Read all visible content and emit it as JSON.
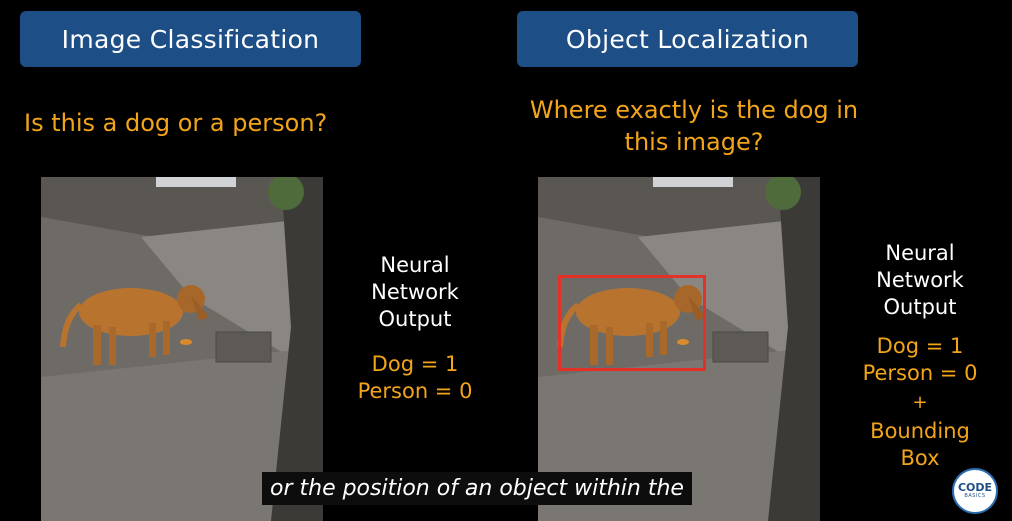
{
  "left_panel": {
    "title": "Image Classification",
    "question": "Is this a dog or a person?",
    "nn_output_label": [
      "Neural",
      "Network",
      "Output"
    ],
    "outputs": [
      "Dog = 1",
      "Person = 0"
    ]
  },
  "right_panel": {
    "title": "Object Localization",
    "question_lines": [
      "Where exactly is the dog in",
      "this image?"
    ],
    "nn_output_label": [
      "Neural",
      "Network",
      "Output"
    ],
    "outputs": [
      "Dog = 1",
      "Person = 0"
    ],
    "plus": "+",
    "extra_output": [
      "Bounding",
      "Box"
    ]
  },
  "caption": "or the position of an object within the",
  "logo": {
    "line1": "CODE",
    "line2": "BASICS"
  },
  "colors": {
    "title_bg": "#1d4e86",
    "question": "#f3a51a",
    "bounding_box": "#e53025"
  }
}
